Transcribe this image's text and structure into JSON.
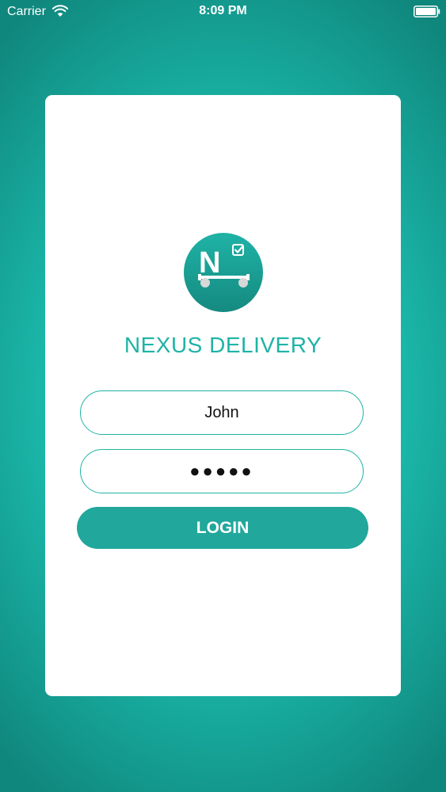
{
  "status_bar": {
    "carrier": "Carrier",
    "time": "8:09 PM",
    "wifi_icon": "wifi-icon",
    "battery_icon": "battery-icon"
  },
  "login_card": {
    "logo": {
      "icon": "delivery-cart-checkmark-logo",
      "letter": "N"
    },
    "title": "NEXUS DELIVERY",
    "username": {
      "value": "John"
    },
    "password": {
      "masked_value": "●●●●●"
    },
    "login_label": "LOGIN"
  },
  "colors": {
    "accent": "#1fb3a6",
    "button": "#21a79c",
    "background": "#1cbfb1",
    "card": "#ffffff"
  }
}
